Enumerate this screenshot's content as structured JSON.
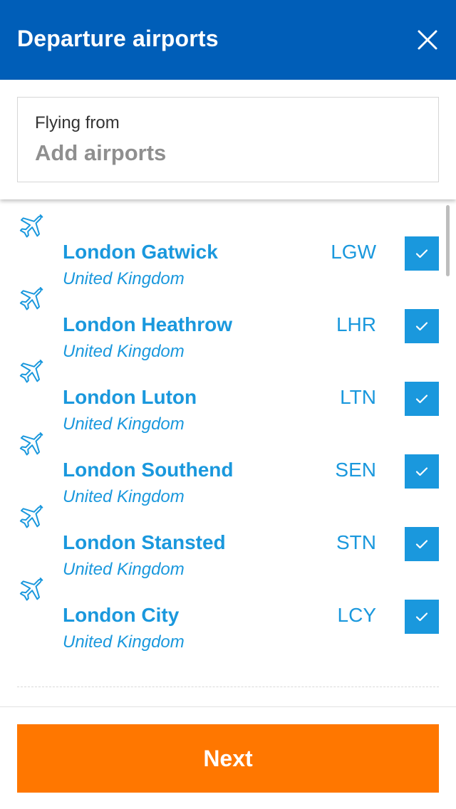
{
  "header": {
    "title": "Departure airports",
    "close_icon": "close-icon"
  },
  "search": {
    "label": "Flying from",
    "placeholder": "Add airports",
    "value": ""
  },
  "colors": {
    "header_bg": "#005eb8",
    "accent": "#1a98dd",
    "next_button": "#ff7700"
  },
  "airports": [
    {
      "name": "London Gatwick",
      "country": "United Kingdom",
      "code": "LGW",
      "selected": true,
      "icon": "plane-icon"
    },
    {
      "name": "London Heathrow",
      "country": "United Kingdom",
      "code": "LHR",
      "selected": true,
      "icon": "plane-icon"
    },
    {
      "name": "London Luton",
      "country": "United Kingdom",
      "code": "LTN",
      "selected": true,
      "icon": "plane-icon"
    },
    {
      "name": "London Southend",
      "country": "United Kingdom",
      "code": "SEN",
      "selected": true,
      "icon": "plane-icon"
    },
    {
      "name": "London Stansted",
      "country": "United Kingdom",
      "code": "STN",
      "selected": true,
      "icon": "plane-icon"
    },
    {
      "name": "London City",
      "country": "United Kingdom",
      "code": "LCY",
      "selected": true,
      "icon": "plane-icon"
    }
  ],
  "footer": {
    "next_label": "Next"
  }
}
